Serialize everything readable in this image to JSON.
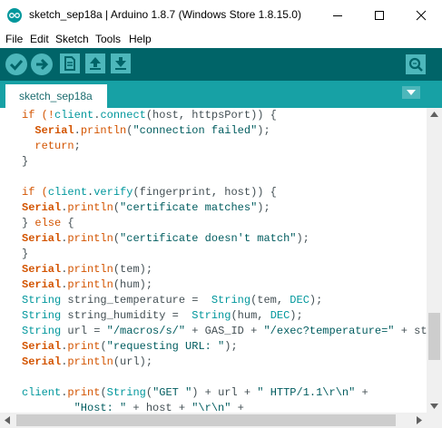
{
  "window": {
    "title": "sketch_sep18a | Arduino 1.8.7 (Windows Store 1.8.15.0)",
    "controls": {
      "minimize": "minimize",
      "maximize": "maximize",
      "close": "close"
    }
  },
  "menu": {
    "file": "File",
    "edit": "Edit",
    "sketch": "Sketch",
    "tools": "Tools",
    "help": "Help"
  },
  "toolbar": {
    "verify": "verify-icon",
    "upload": "upload-icon",
    "new": "new-icon",
    "open": "open-icon",
    "save": "save-icon",
    "serial_monitor": "serial-monitor-icon"
  },
  "tabs": [
    {
      "label": "sketch_sep18a"
    }
  ],
  "colors": {
    "toolbar_bg": "#006468",
    "tabstrip_bg": "#17a1a5",
    "button_bg": "#4db7bb",
    "keyword_orange": "#d35400",
    "keyword_teal": "#00979c",
    "string_color": "#005c5f"
  },
  "code": {
    "l1": {
      "a": "if (!",
      "b": "client",
      "c": ".",
      "d": "connect",
      "e": "(host, httpsPort)) {"
    },
    "l2": {
      "a": "Serial",
      "b": ".",
      "c": "println",
      "d": "(",
      "e": "\"connection failed\"",
      "f": ");"
    },
    "l3": {
      "a": "return",
      "b": ";"
    },
    "l4": {
      "a": "}"
    },
    "l6": {
      "a": "if (",
      "b": "client",
      "c": ".",
      "d": "verify",
      "e": "(fingerprint, host)) {"
    },
    "l7": {
      "a": "Serial",
      "b": ".",
      "c": "println",
      "d": "(",
      "e": "\"certificate matches\"",
      "f": ");"
    },
    "l8": {
      "a": "} ",
      "b": "else",
      "c": " {"
    },
    "l9": {
      "a": "Serial",
      "b": ".",
      "c": "println",
      "d": "(",
      "e": "\"certificate doesn't match\"",
      "f": ");"
    },
    "l10": {
      "a": "}"
    },
    "l11": {
      "a": "Serial",
      "b": ".",
      "c": "println",
      "d": "(tem);"
    },
    "l12": {
      "a": "Serial",
      "b": ".",
      "c": "println",
      "d": "(hum);"
    },
    "l13": {
      "a": "String",
      "b": " string_temperature =  ",
      "c": "String",
      "d": "(tem, ",
      "e": "DEC",
      "f": ");"
    },
    "l14": {
      "a": "String",
      "b": " string_humidity =  ",
      "c": "String",
      "d": "(hum, ",
      "e": "DEC",
      "f": ");"
    },
    "l15": {
      "a": "String",
      "b": " url = ",
      "c": "\"/macros/s/\"",
      "d": " + GAS_ID + ",
      "e": "\"/exec?temperature=\"",
      "f": " + stri"
    },
    "l16": {
      "a": "Serial",
      "b": ".",
      "c": "print",
      "d": "(",
      "e": "\"requesting URL: \"",
      "f": ");"
    },
    "l17": {
      "a": "Serial",
      "b": ".",
      "c": "println",
      "d": "(url);"
    },
    "l19": {
      "a": "client",
      "b": ".",
      "c": "print",
      "d": "(",
      "e": "String",
      "f": "(",
      "g": "\"GET \"",
      "h": ") + url + ",
      "i": "\" HTTP/1.1\\r\\n\"",
      "j": " +"
    },
    "l20": {
      "a": "\"Host: \"",
      "b": " + host + ",
      "c": "\"\\r\\n\"",
      "d": " +"
    }
  }
}
